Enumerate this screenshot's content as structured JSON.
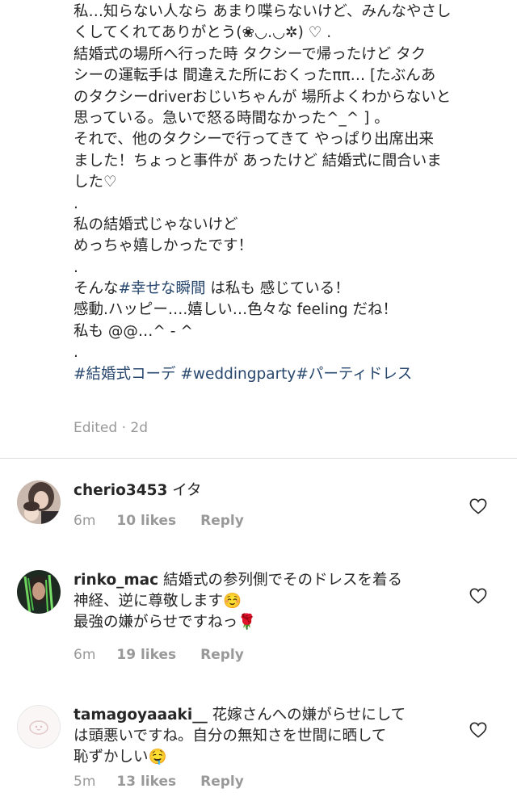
{
  "caption": {
    "lines": [
      "私…知らない人なら あまり喋らないけど、みんなやさし",
      "くしてくれてありがとう(❀◡.◡✲) ♡ .",
      "結婚式の場所へ行った時 タクシーで帰ったけど タク",
      "シーの運転手は 間違えた所におくったππ… [たぶんあ",
      "のタクシーdriverおじいちゃんが 場所よくわからないと",
      "思っている。急いで怒る時間なかった^_^ ] 。",
      "それで、他のタクシーで行ってきて やっぱり出席出来",
      "ました！ちょっと事件が あったけど 結婚式に間合いま",
      "した♡",
      ".",
      "私の結婚式じゃないけど",
      "めっちゃ嬉しかったです！",
      ".",
      "感動.ハッピー….嬉しい…色々な feeling だね！",
      "私も @@…^ - ^",
      "."
    ],
    "line13_prefix": "そんな",
    "line13_hashtag": "#幸せな瞬間",
    "line13_suffix": " は私も 感じている！",
    "hashtags": "#結婚式コーデ #weddingparty#パーティドレス",
    "edited": "Edited · 2d"
  },
  "comments": [
    {
      "username": "cherio3453",
      "lines": [
        " イタ"
      ],
      "time": "6m",
      "likes": "10 likes",
      "reply": "Reply"
    },
    {
      "username": "rinko_mac",
      "lines": [
        " 結婚式の参列側でそのドレスを着る",
        "神経、逆に尊敬します☺️",
        "最強の嫌がらせですねっ🌹"
      ],
      "time": "6m",
      "likes": "19 likes",
      "reply": "Reply"
    },
    {
      "username": "tamagoyaaaki__",
      "lines": [
        " 花嫁さんへの嫌がらせにして",
        "は頭悪いですね。自分の無知さを世間に晒して",
        "恥ずかしい🤤"
      ],
      "time": "5m",
      "likes": "13 likes",
      "reply": "Reply"
    }
  ],
  "icons": {
    "like": "heart-outline-icon"
  },
  "colors": {
    "text": "#262626",
    "hashtag": "#27476e",
    "meta": "#999999",
    "divider": "#dbdbdb"
  }
}
